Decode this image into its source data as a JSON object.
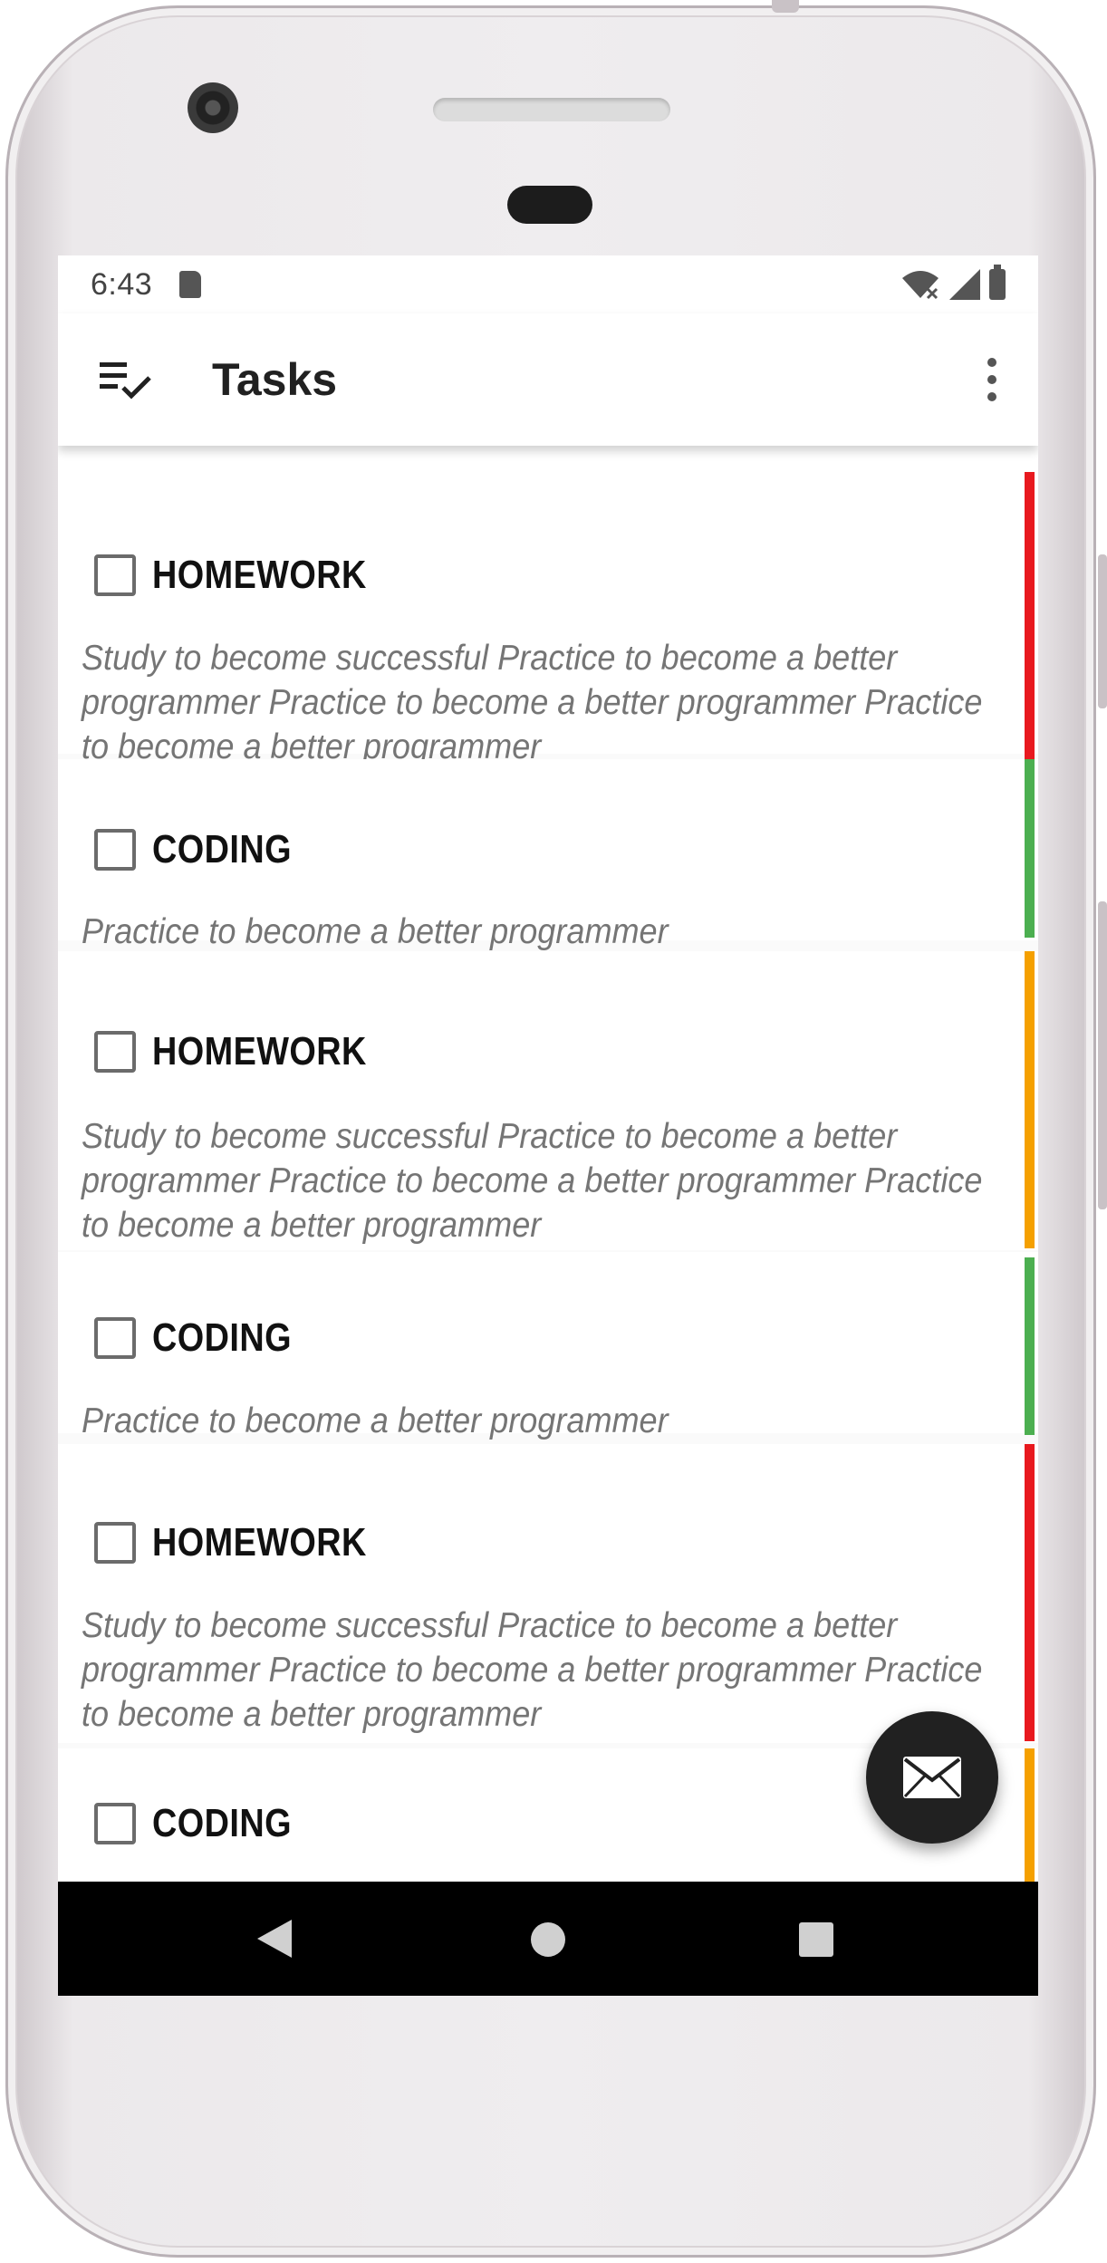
{
  "status_bar": {
    "time": "6:43",
    "icons": [
      "sd-card-icon",
      "wifi-icon",
      "signal-icon",
      "battery-icon"
    ]
  },
  "app_bar": {
    "title": "Tasks",
    "nav_icon": "checklist-icon",
    "menu_icon": "more-vert-icon"
  },
  "tasks": [
    {
      "title": "HOMEWORK",
      "description": "Study to become successful Practice to become a better programmer Practice to become a better programmer Practice to become a better programmer",
      "priority_color": "#e8191f",
      "checked": false
    },
    {
      "title": "CODING",
      "description": "Practice to become a better programmer",
      "priority_color": "#4caf50",
      "checked": false
    },
    {
      "title": "HOMEWORK",
      "description": "Study to become successful Practice to become a better programmer Practice to become a better programmer Practice to become a better programmer",
      "priority_color": "#f5a000",
      "checked": false
    },
    {
      "title": "CODING",
      "description": "Practice to become a better programmer",
      "priority_color": "#4caf50",
      "checked": false
    },
    {
      "title": "HOMEWORK",
      "description": "Study to become successful Practice to become a better programmer Practice to become a better programmer Practice to become a better programmer",
      "priority_color": "#e8191f",
      "checked": false
    },
    {
      "title": "CODING",
      "description": "",
      "priority_color": "#f5a000",
      "checked": false
    }
  ],
  "fab": {
    "icon": "mail-icon"
  },
  "nav_bar": {
    "icons": [
      "back-icon",
      "home-icon",
      "recents-icon"
    ]
  },
  "colors": {
    "app_bar_bg": "#ffffff",
    "fab_bg": "#212121",
    "title_text": "#212121",
    "description_text": "#757575"
  }
}
